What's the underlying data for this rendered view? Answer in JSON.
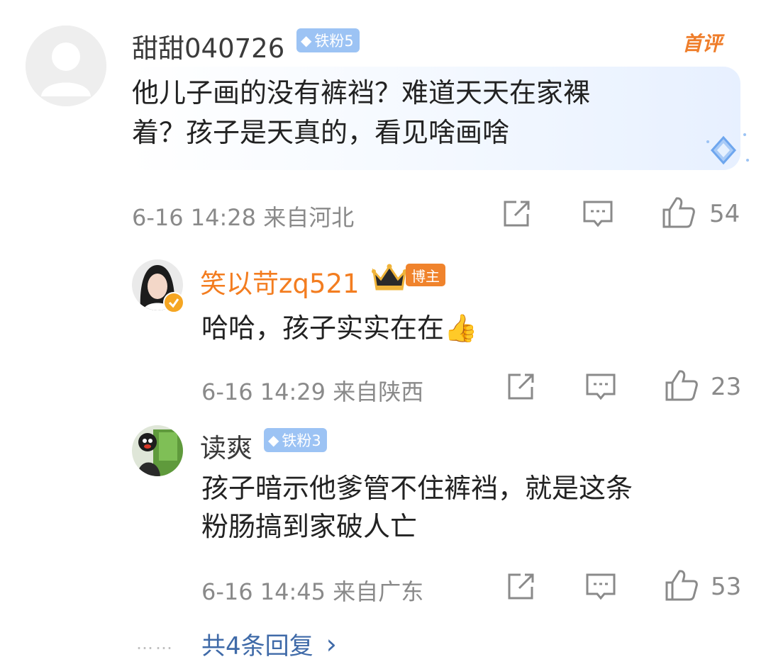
{
  "comment": {
    "username": "甜甜040726",
    "fan_badge": "铁粉5",
    "first_label": "首评",
    "text_lines": [
      "他儿子画的没有裤裆？难道天天在家裸",
      "着？孩子是天真的，看见啥画啥"
    ],
    "meta": "6-16 14:28 来自河北",
    "likes": "54"
  },
  "replies": [
    {
      "username": "笑以苛zq521",
      "badge": "博主",
      "text_lines": [
        "哈哈，孩子实实在在👍"
      ],
      "meta": "6-16 14:29 来自陕西",
      "likes": "23"
    },
    {
      "username": "读爽",
      "badge": "铁粉3",
      "text_lines": [
        "孩子暗示他爹管不住裤裆，就是这条",
        "粉肠搞到家破人亡"
      ],
      "meta": "6-16 14:45 来自广东",
      "likes": "53"
    }
  ],
  "more_replies": {
    "dots": "……",
    "label": "共4条回复",
    "chevron": "›"
  },
  "icons": [
    "avatar-placeholder-icon",
    "diamond-icon",
    "share-icon",
    "comment-icon",
    "like-icon",
    "crown-icon",
    "verified-icon"
  ],
  "colors": {
    "username_orange": "#f37d20",
    "badge_blue": "#9cc3f4",
    "link_blue": "#3f6aa8",
    "meta_gray": "#8a8a8a"
  }
}
